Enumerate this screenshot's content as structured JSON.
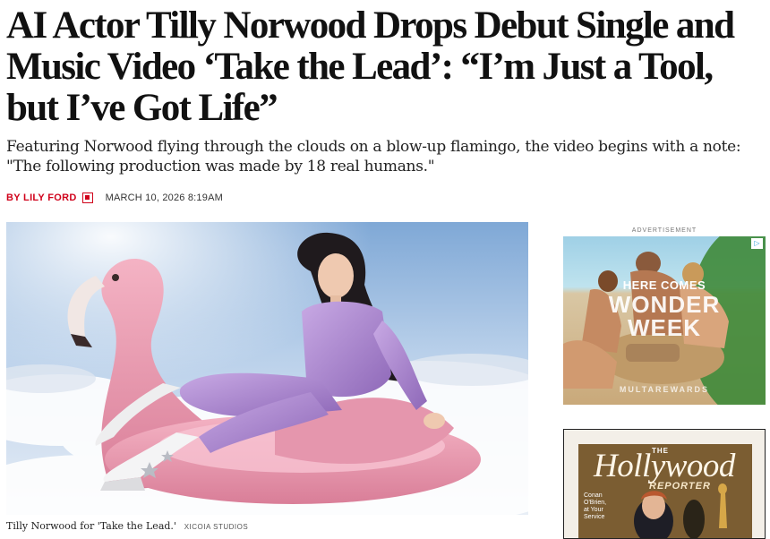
{
  "article": {
    "headline": "AI Actor Tilly Norwood Drops Debut Single and Music Video ‘Take the Lead’: “I’m Just a Tool, but I’ve Got Life”",
    "dek": "Featuring Norwood flying through the clouds on a blow-up flamingo, the video begins with a note: \"The following production was made by 18 real humans.\"",
    "byline_prefix": "BY",
    "author": "LILY FORD",
    "date": "MARCH 10, 2026 8:19AM",
    "caption": "Tilly Norwood for 'Take the Lead.'",
    "credit": "XICOIA STUDIOS"
  },
  "sidebar": {
    "ad_label": "ADVERTISEMENT",
    "ad1": {
      "kicker": "HERE COMES",
      "title_line1": "WONDER",
      "title_line2": "WEEK",
      "brand": "MULTAREWARDS",
      "choices_icon": "▷"
    },
    "ad2": {
      "the": "THE",
      "title": "Hollywood",
      "subtitle": "REPORTER",
      "cover_line1": "Conan",
      "cover_line2": "O'Brien,",
      "cover_line3": "at Your",
      "cover_line4": "Service"
    }
  },
  "colors": {
    "accent": "#d0021b",
    "text": "#111111"
  },
  "icons": {
    "author_badge": "author-badge-icon",
    "ad_choices": "ad-choices-icon"
  }
}
